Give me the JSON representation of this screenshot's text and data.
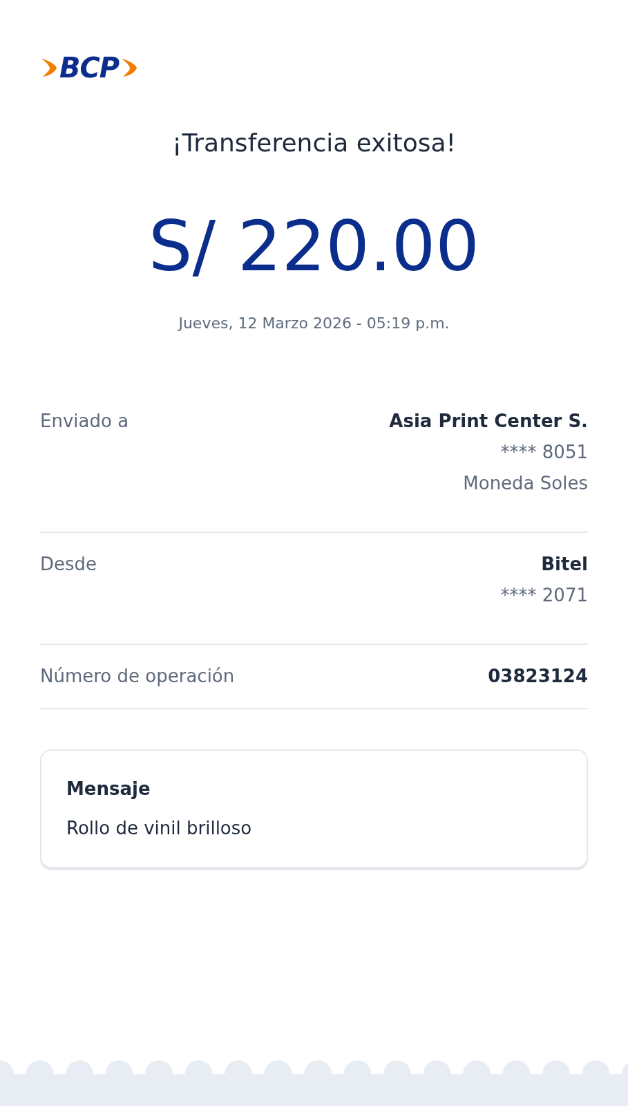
{
  "logo": {
    "text": "BCP"
  },
  "title": "¡Transferencia exitosa!",
  "amount": "S/ 220.00",
  "datetime": "Jueves, 12 Marzo 2026 - 05:19 p.m.",
  "details": [
    {
      "label": "Enviado a",
      "values": [
        {
          "text": "Asia Print Center S.",
          "kind": "strong"
        },
        {
          "text": "**** 8051",
          "kind": "plain"
        },
        {
          "text": "Moneda Soles",
          "kind": "plain"
        }
      ]
    },
    {
      "label": "Desde",
      "values": [
        {
          "text": "Bitel",
          "kind": "strong"
        },
        {
          "text": "**** 2071",
          "kind": "plain"
        }
      ]
    },
    {
      "label": "Número de operación",
      "values": [
        {
          "text": "03823124",
          "kind": "strong"
        }
      ]
    }
  ],
  "message": {
    "title": "Mensaje",
    "text": "Rollo de vinil brilloso"
  }
}
